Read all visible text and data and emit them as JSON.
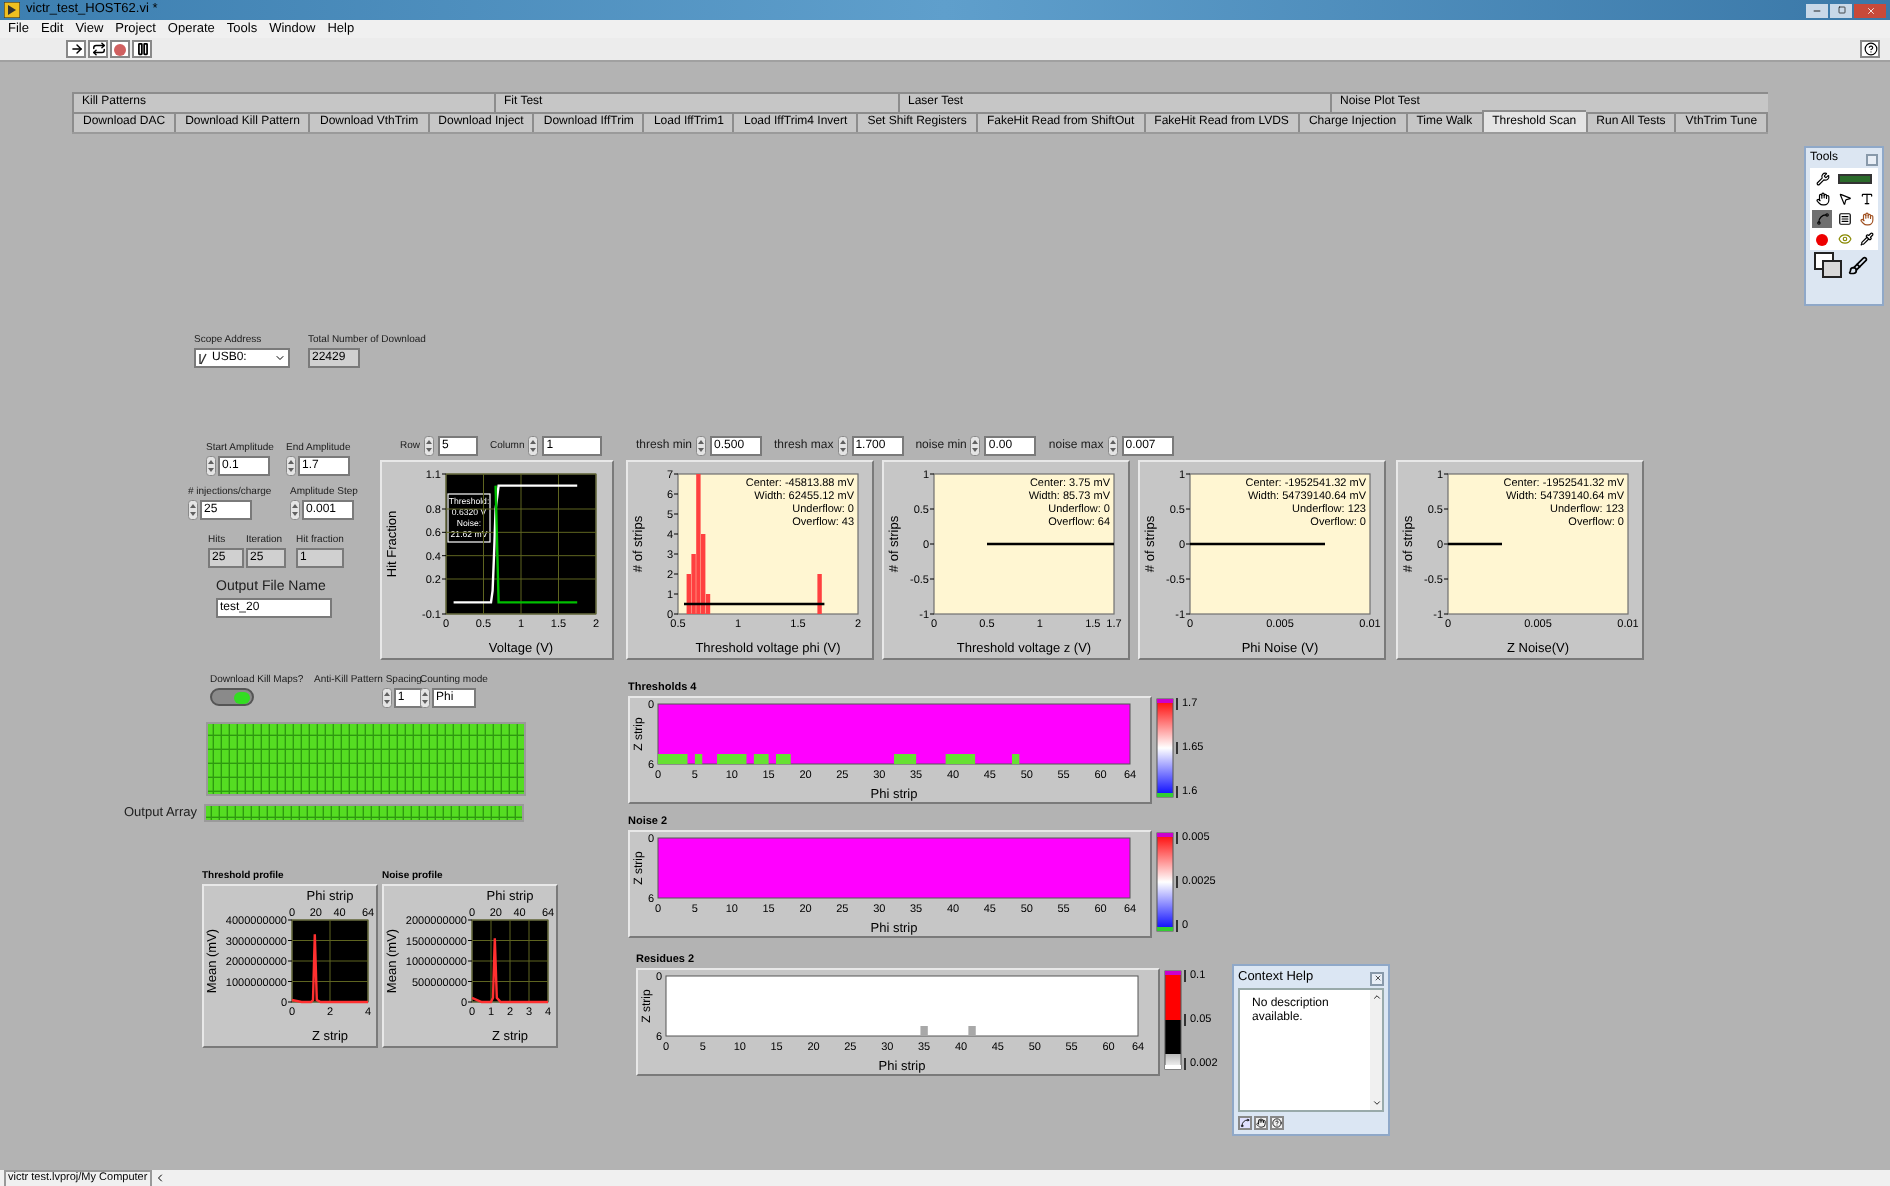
{
  "window": {
    "title": "victr_test_HOST62.vi *"
  },
  "menu": [
    "File",
    "Edit",
    "View",
    "Project",
    "Operate",
    "Tools",
    "Window",
    "Help"
  ],
  "tab_pages": [
    "Kill Patterns",
    "Fit Test",
    "Laser Test",
    "Noise Plot Test"
  ],
  "tabs": [
    {
      "label": "Download DAC",
      "selected": false
    },
    {
      "label": "Download Kill Pattern",
      "selected": false
    },
    {
      "label": "Download VthTrim",
      "selected": false
    },
    {
      "label": "Download Inject",
      "selected": false
    },
    {
      "label": "Download IffTrim",
      "selected": false
    },
    {
      "label": "Load IffTrim1",
      "selected": false
    },
    {
      "label": "Load IffTrim4 Invert",
      "selected": false
    },
    {
      "label": "Set Shift Registers",
      "selected": false
    },
    {
      "label": "FakeHit Read from ShiftOut",
      "selected": false
    },
    {
      "label": "FakeHit Read from LVDS",
      "selected": false
    },
    {
      "label": "Charge Injection",
      "selected": false
    },
    {
      "label": "Time Walk",
      "selected": false
    },
    {
      "label": "Threshold Scan",
      "selected": true
    },
    {
      "label": "Run All Tests",
      "selected": false
    },
    {
      "label": "VthTrim Tune",
      "selected": false
    }
  ],
  "scope_address": {
    "label": "Scope Address",
    "value": "USB0:"
  },
  "total_downloads": {
    "label": "Total Number of Download",
    "value": "22429"
  },
  "amplitude_fields": [
    {
      "label": "Start Amplitude",
      "value": "0.1"
    },
    {
      "label": "End Amplitude",
      "value": "1.7"
    },
    {
      "label": "# injections/charge",
      "value": "25"
    },
    {
      "label": "Amplitude Step",
      "value": "0.001"
    }
  ],
  "indicators": [
    {
      "label": "Hits",
      "value": "25"
    },
    {
      "label": "Iteration",
      "value": "25"
    },
    {
      "label": "Hit fraction",
      "value": "1"
    }
  ],
  "output_file": {
    "label": "Output File Name",
    "value": "test_20"
  },
  "pixel": [
    {
      "label": "Row",
      "value": "5"
    },
    {
      "label": "Column",
      "value": "1"
    }
  ],
  "ranges": [
    {
      "label": "thresh min",
      "value": "0.500"
    },
    {
      "label": "thresh max",
      "value": "1.700"
    },
    {
      "label": "noise min",
      "value": "0.00"
    },
    {
      "label": "noise max",
      "value": "0.007"
    }
  ],
  "hit_graph": {
    "chart_data": {
      "type": "line",
      "xlabel": "Voltage (V)",
      "ylabel": "Hit Fraction",
      "grid": true,
      "x": [
        0.1,
        0.6,
        0.62,
        0.64,
        0.66,
        0.7,
        1.75
      ],
      "series": [
        {
          "color": "#ffffff",
          "values": [
            0,
            0,
            0.1,
            0.4,
            0.8,
            1,
            1
          ]
        },
        {
          "color": "#00c000",
          "values": [
            null,
            null,
            null,
            null,
            1,
            0,
            0
          ]
        }
      ],
      "xlim": [
        0,
        2
      ],
      "ylim": [
        -0.1,
        1.1
      ],
      "xticks": [
        0,
        0.5,
        1,
        1.5,
        2
      ],
      "yticks": [
        -0.1,
        0.2,
        0.4,
        0.6,
        0.8,
        1.1
      ],
      "annotations": [
        "Threshold:",
        "0.6320 V",
        "Noise:",
        "21.62 mV"
      ]
    }
  },
  "histograms": [
    {
      "chart_data": {
        "type": "bar",
        "xlabel": "Threshold voltage phi (V)",
        "ylabel": "# of strips",
        "x": [
          0.55,
          0.59,
          0.63,
          0.67,
          0.71,
          0.75,
          1.68,
          1.72
        ],
        "series": [
          {
            "type": "bar",
            "color": "#ff4040",
            "values": [
              0,
              2,
              3,
              7,
              4,
              1,
              2,
              0
            ]
          },
          {
            "type": "line",
            "color": "#000000",
            "values": [
              0.5,
              0.5,
              0.5,
              0.5,
              0.5,
              0.5,
              0.5,
              0.5
            ]
          }
        ],
        "xlim": [
          0.5,
          2
        ],
        "ylim": [
          0,
          7
        ],
        "xticks": [
          0.5,
          1,
          1.5,
          2
        ],
        "yticks": [
          0,
          1,
          2,
          3,
          4,
          5,
          6,
          7
        ],
        "annotations": [
          "Center: -45813.88 mV",
          "Width: 62455.12 mV",
          "Underflow: 0",
          "Overflow: 43"
        ]
      }
    },
    {
      "chart_data": {
        "type": "line",
        "xlabel": "Threshold voltage z (V)",
        "ylabel": "# of strips",
        "x": [
          0.5,
          1.7
        ],
        "series": [
          {
            "color": "#000000",
            "values": [
              0,
              0
            ]
          }
        ],
        "xlim": [
          0,
          1.7
        ],
        "ylim": [
          -1,
          1
        ],
        "xticks": [
          0,
          0.5,
          1,
          1.5,
          1.7
        ],
        "yticks": [
          -1,
          -0.5,
          0,
          0.5,
          1
        ],
        "annotations": [
          "Center: 3.75 mV",
          "Width: 85.73 mV",
          "Underflow: 0",
          "Overflow: 64"
        ]
      }
    },
    {
      "chart_data": {
        "type": "line",
        "xlabel": "Phi Noise (V)",
        "ylabel": "# of strips",
        "x": [
          0,
          0.0075
        ],
        "series": [
          {
            "color": "#000000",
            "values": [
              0,
              0
            ]
          }
        ],
        "xlim": [
          0,
          0.01
        ],
        "ylim": [
          -1,
          1
        ],
        "xticks": [
          0,
          0.005,
          0.01
        ],
        "yticks": [
          -1,
          -0.5,
          0,
          0.5,
          1
        ],
        "annotations": [
          "Center: -1952541.32 mV",
          "Width: 54739140.64 mV",
          "Underflow: 123",
          "Overflow: 0"
        ]
      }
    },
    {
      "chart_data": {
        "type": "line",
        "xlabel": "Z Noise(V)",
        "ylabel": "# of strips",
        "x": [
          0,
          0.003
        ],
        "series": [
          {
            "color": "#000000",
            "values": [
              0,
              0
            ]
          }
        ],
        "xlim": [
          0,
          0.01
        ],
        "ylim": [
          -1,
          1
        ],
        "xticks": [
          0,
          0.005,
          0.01
        ],
        "yticks": [
          -1,
          -0.5,
          0,
          0.5,
          1
        ],
        "annotations": [
          "Center: -1952541.32 mV",
          "Width: 54739140.64 mV",
          "Underflow: 123",
          "Overflow: 0"
        ]
      }
    }
  ],
  "kill_maps": {
    "label": "Download Kill Maps?",
    "on": true
  },
  "anti_kill": {
    "label": "Anti-Kill Pattern Spacing",
    "value": "1"
  },
  "counting_mode": {
    "label": "Counting mode",
    "value": "Phi"
  },
  "output_array": {
    "label": "Output Array"
  },
  "profiles": [
    {
      "title": "Threshold profile",
      "chart_data": {
        "type": "line",
        "xlabel": "Z strip",
        "ylabel": "Mean (mV)",
        "grid": true,
        "x2label": "Phi strip",
        "x2lim": [
          0,
          64
        ],
        "x2ticks": [
          0,
          20,
          40,
          64
        ],
        "x": [
          0,
          0.5,
          1,
          1.1,
          1.2,
          1.3,
          1.5,
          2,
          3,
          4
        ],
        "series": [
          {
            "color": "#ff3030",
            "values": [
              100000000,
              0,
              0,
              100000000,
              3300000000,
              100000000,
              0,
              0,
              0,
              0
            ]
          }
        ],
        "xlim": [
          0,
          4
        ],
        "ylim": [
          0,
          4000000000
        ],
        "xticks": [
          0,
          2,
          4
        ],
        "yticks": [
          0,
          1000000000,
          2000000000,
          3000000000,
          4000000000
        ]
      }
    },
    {
      "title": "Noise profile",
      "chart_data": {
        "type": "line",
        "xlabel": "Z strip",
        "ylabel": "Mean (mV)",
        "grid": true,
        "x2label": "Phi strip",
        "x2lim": [
          0,
          64
        ],
        "x2ticks": [
          0,
          20,
          40,
          64
        ],
        "x": [
          0,
          0.5,
          1,
          1.1,
          1.2,
          1.3,
          1.5,
          2,
          3,
          4
        ],
        "series": [
          {
            "color": "#ff3030",
            "values": [
              100000000,
              0,
              0,
              100000000,
              1550000000,
              100000000,
              0,
              0,
              0,
              0
            ]
          }
        ],
        "xlim": [
          0,
          4
        ],
        "ylim": [
          0,
          2000000000
        ],
        "xticks": [
          0,
          1,
          2,
          3,
          4
        ],
        "yticks": [
          0,
          500000000,
          1000000000,
          1500000000,
          2000000000
        ]
      }
    }
  ],
  "intensity_graphs": [
    {
      "title": "Thresholds 4",
      "kind": "thresholds",
      "xlabel": "Phi strip",
      "ylabel": "Z strip",
      "xticks": [
        "0",
        "5",
        "10",
        "15",
        "20",
        "25",
        "30",
        "35",
        "40",
        "45",
        "50",
        "55",
        "60",
        "64"
      ],
      "yticks": [
        "0",
        "6"
      ],
      "scale": {
        "kind": "diverging",
        "ticks": [
          "1.7",
          "1.65",
          "1.6"
        ]
      }
    },
    {
      "title": "Noise 2",
      "kind": "noise",
      "xlabel": "Phi strip",
      "ylabel": "Z strip",
      "xticks": [
        "0",
        "5",
        "10",
        "15",
        "20",
        "25",
        "30",
        "35",
        "40",
        "45",
        "50",
        "55",
        "60",
        "64"
      ],
      "yticks": [
        "0",
        "6"
      ],
      "scale": {
        "kind": "diverging",
        "ticks": [
          "0.005",
          "0.0025",
          "0"
        ]
      }
    },
    {
      "title": "Residues 2",
      "kind": "residues",
      "xlabel": "Phi strip",
      "ylabel": "Z strip",
      "xticks": [
        "0",
        "5",
        "10",
        "15",
        "20",
        "25",
        "30",
        "35",
        "40",
        "45",
        "50",
        "55",
        "60",
        "64"
      ],
      "yticks": [
        "0",
        "6"
      ],
      "scale": {
        "kind": "stepped",
        "ticks": [
          "0.1",
          "0.05",
          "0.002"
        ]
      }
    }
  ],
  "context_help": {
    "title": "Context Help",
    "text": "No description available."
  },
  "tools_palette": {
    "title": "Tools"
  },
  "status_bar": {
    "path": "victr test.lvproj/My Computer"
  }
}
